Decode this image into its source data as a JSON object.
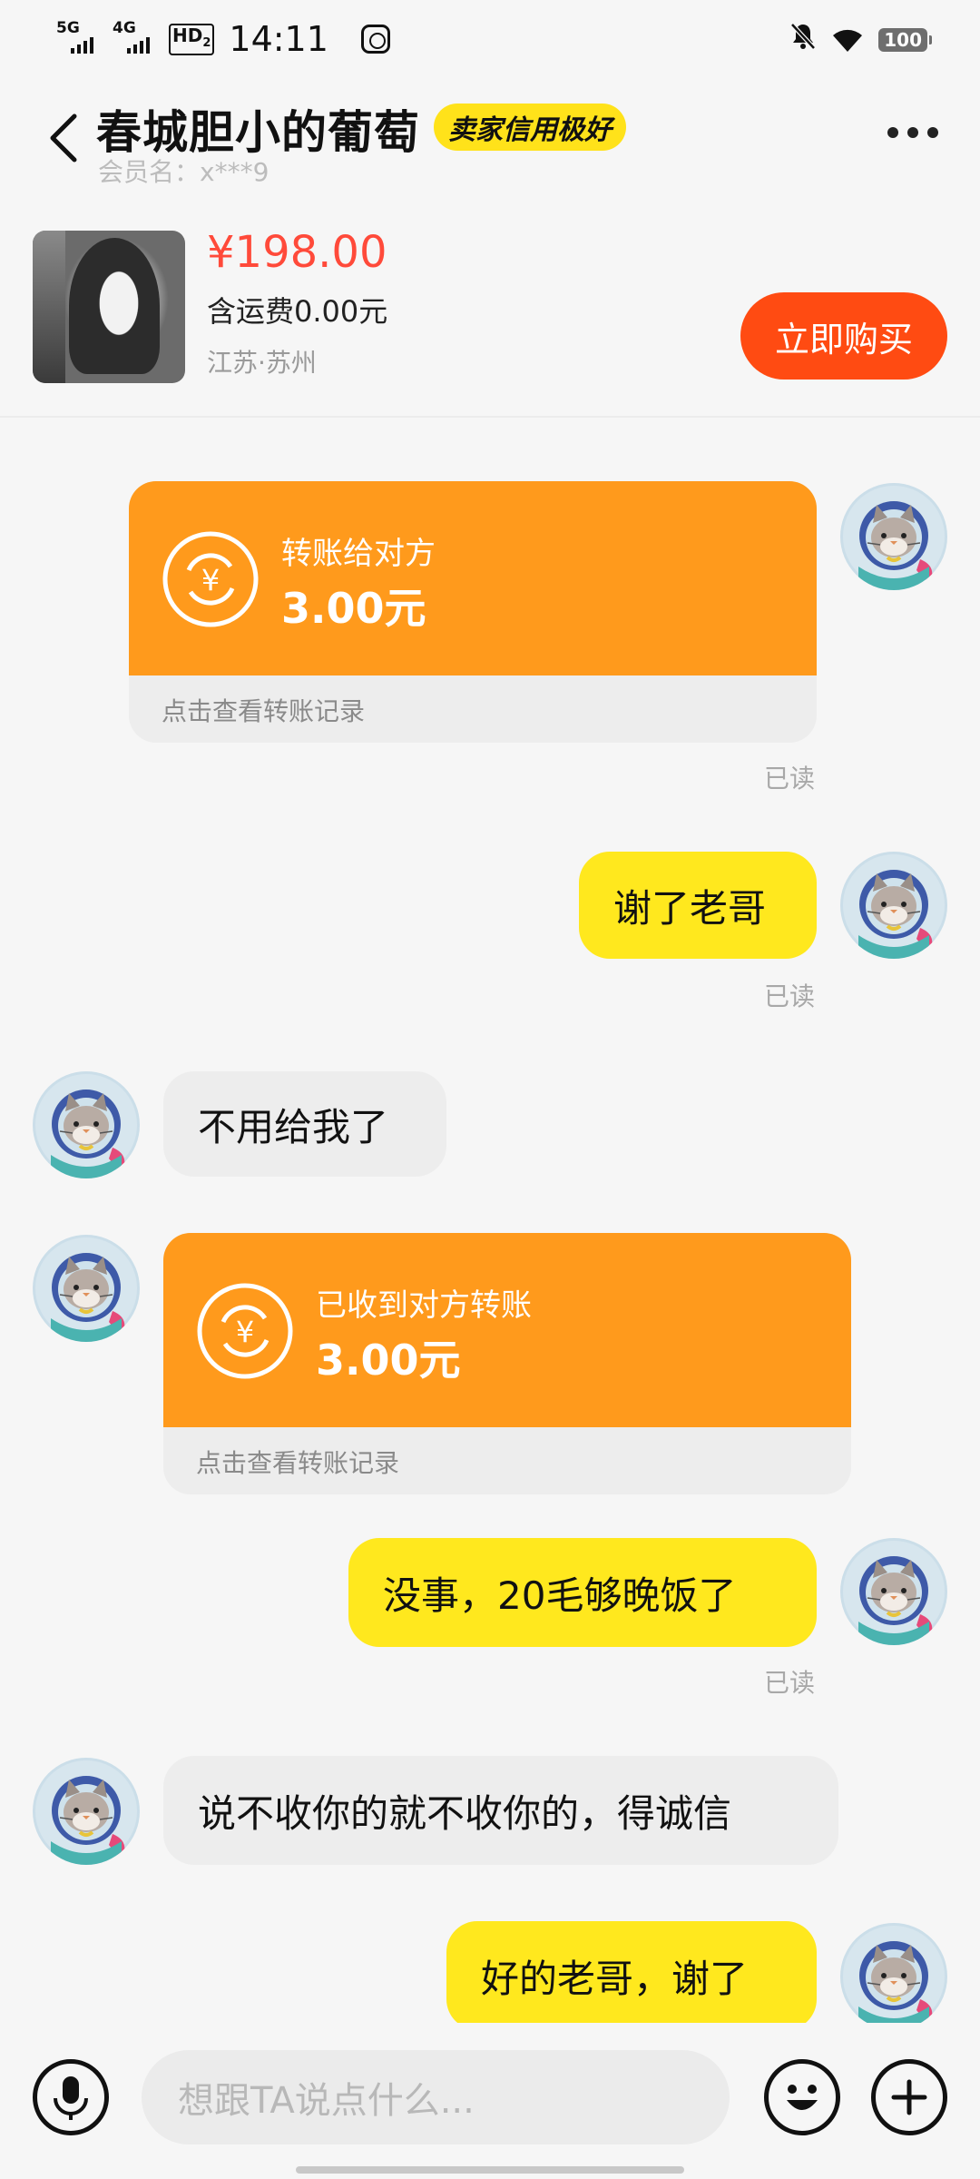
{
  "status_bar": {
    "signal1": "5G",
    "signal2": "4G",
    "hd": "HD",
    "hd_sub": "2",
    "time": "14:11",
    "battery": "100"
  },
  "header": {
    "title": "春城胆小的葡萄",
    "badge": "卖家信用极好",
    "member": "会员名：x***9"
  },
  "product": {
    "price": "¥198.00",
    "shipping": "含运费0.00元",
    "location": "江苏·苏州",
    "buy_label": "立即购买"
  },
  "messages": {
    "m1": {
      "label": "转账给对方",
      "amount": "3.00元",
      "footer": "点击查看转账记录",
      "read": "已读"
    },
    "m2": {
      "text": "谢了老哥",
      "read": "已读"
    },
    "m3": {
      "text": "不用给我了"
    },
    "m4": {
      "label": "已收到对方转账",
      "amount": "3.00元",
      "footer": "点击查看转账记录"
    },
    "m5": {
      "text": "没事，20毛够晚饭了",
      "read": "已读"
    },
    "m6": {
      "text": "说不收你的就不收你的，得诚信"
    },
    "m7": {
      "text": "好的老哥，谢了"
    }
  },
  "input_bar": {
    "placeholder": "想跟TA说点什么..."
  },
  "colors": {
    "accent_yellow": "#ffe81e",
    "transfer_orange": "#ff9a1c",
    "price_red": "#ff4a3a",
    "buy_button": "#ff4b12"
  }
}
